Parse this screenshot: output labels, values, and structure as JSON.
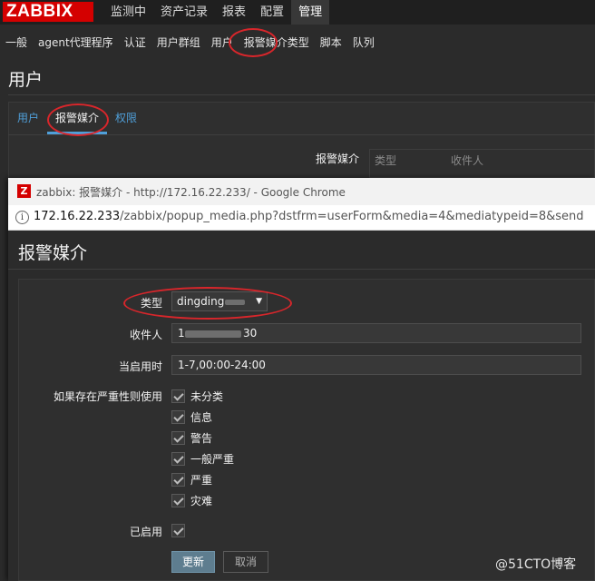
{
  "app": {
    "logo": "ZABBIX",
    "main_menu": [
      "监测中",
      "资产记录",
      "报表",
      "配置",
      "管理"
    ],
    "main_menu_active": "管理",
    "sub_menu": [
      "一般",
      "agent代理程序",
      "认证",
      "用户群组",
      "用户",
      "报警媒介类型",
      "脚本",
      "队列"
    ],
    "sub_menu_active": "用户",
    "page_title": "用户",
    "tabs": [
      "用户",
      "报警媒介",
      "权限"
    ],
    "tab_active": "报警媒介",
    "media_label": "报警媒介",
    "media_table_headers": [
      "类型",
      "收件人"
    ]
  },
  "browser": {
    "window_title": "zabbix: 报警媒介 - http://172.16.22.233/ - Google Chrome",
    "url_host": "172.16.22.233",
    "url_path": "/zabbix/popup_media.php?dstfrm=userForm&media=4&mediatypeid=8&send"
  },
  "form": {
    "title": "报警媒介",
    "type_label": "类型",
    "type_value": "dingding",
    "sendto_label": "收件人",
    "sendto_value_start": "1",
    "sendto_value_end": "30",
    "period_label": "当启用时",
    "period_value": "1-7,00:00-24:00",
    "severity_label": "如果存在严重性则使用",
    "severities": [
      {
        "label": "未分类",
        "checked": true
      },
      {
        "label": "信息",
        "checked": true
      },
      {
        "label": "警告",
        "checked": true
      },
      {
        "label": "一般严重",
        "checked": true
      },
      {
        "label": "严重",
        "checked": true
      },
      {
        "label": "灾难",
        "checked": true
      }
    ],
    "enabled_label": "已启用",
    "enabled": true,
    "update_button": "更新",
    "cancel_button": "取消"
  },
  "watermark": "@51CTO博客",
  "colors": {
    "annotation": "#d8262b",
    "logo_red": "#d40000",
    "link_blue": "#4f9fd9",
    "primary_button": "#5e7d8f"
  }
}
